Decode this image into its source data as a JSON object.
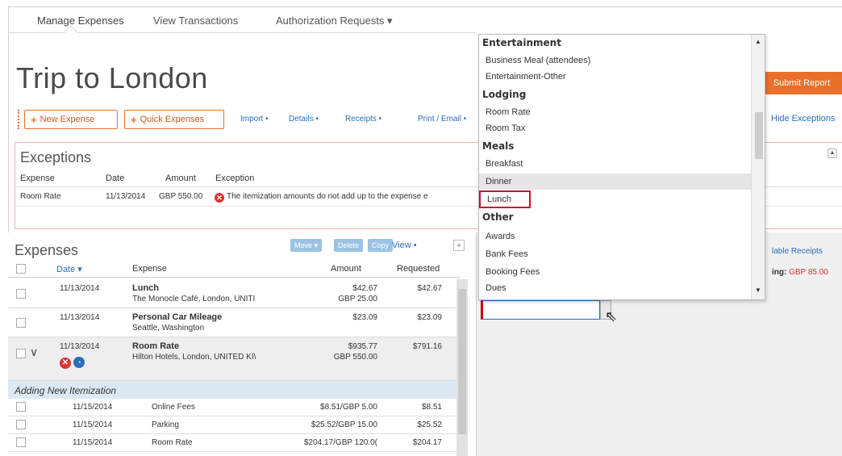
{
  "nav": {
    "tabs": [
      "Manage Expenses",
      "View Transactions",
      "Authorization Requests ▾"
    ]
  },
  "report": {
    "title": "Trip to London",
    "submit_label": "Submit Report"
  },
  "toolbar": {
    "new_expense": "New Expense",
    "quick_expenses": "Quick Expenses",
    "import": "Import •",
    "details": "Details •",
    "receipts": "Receipts •",
    "print_email": "Print / Email •",
    "hide_exceptions": "Hide Exceptions"
  },
  "exceptions": {
    "title": "Exceptions",
    "headers": {
      "expense": "Expense",
      "date": "Date",
      "amount": "Amount",
      "exception": "Exception"
    },
    "row": {
      "expense": "Room Rate",
      "date": "11/13/2014",
      "amount": "GBP 550.00",
      "message": "The itemization amounts do not add up to the expense e"
    }
  },
  "expenses": {
    "title": "Expenses",
    "move": "Move ▾",
    "delete": "Delete",
    "copy": "Copy",
    "view": "View •",
    "headers": {
      "date": "Date ▾",
      "expense": "Expense",
      "amount": "Amount",
      "requested": "Requested"
    },
    "rows": [
      {
        "date": "11/13/2014",
        "name": "Lunch",
        "sub": "The Monocle Café, London, UNITI",
        "amount": "$42.67",
        "amount2": "GBP 25.00",
        "requested": "$42.67"
      },
      {
        "date": "11/13/2014",
        "name": "Personal Car Mileage",
        "sub": "Seattle, Washington",
        "amount": "$23.09",
        "amount2": "",
        "requested": "$23.09"
      },
      {
        "date": "11/13/2014",
        "name": "Room Rate",
        "sub": "Hilton Hotels, London, UNITED KI\\",
        "amount": "$935.77",
        "amount2": "GBP 550.00",
        "requested": "$791.16"
      }
    ],
    "adding_label": "Adding New Itemization",
    "itemizations": [
      {
        "date": "11/15/2014",
        "type": "Online Fees",
        "amount": "$8.51/GBP 5.00",
        "requested": "$8.51"
      },
      {
        "date": "11/15/2014",
        "type": "Parking",
        "amount": "$25.52/GBP 15.00",
        "requested": "$25.52"
      },
      {
        "date": "11/15/2014",
        "type": "Room Rate",
        "amount": "$204.17/GBP 120.0(",
        "requested": "$204.17"
      }
    ]
  },
  "right_panel": {
    "available_receipts": "lable Receipts",
    "remaining_label": "ing:",
    "remaining_value": "GBP 85.00"
  },
  "dropdown": {
    "items": [
      {
        "label": "Entertainment",
        "group": true
      },
      {
        "label": "Business Meal (attendees)",
        "group": false
      },
      {
        "label": "Entertainment-Other",
        "group": false
      },
      {
        "label": "Lodging",
        "group": true
      },
      {
        "label": "Room Rate",
        "group": false
      },
      {
        "label": "Room Tax",
        "group": false
      },
      {
        "label": "Meals",
        "group": true
      },
      {
        "label": "Breakfast",
        "group": false
      },
      {
        "label": "Dinner",
        "group": false
      },
      {
        "label": "Lunch",
        "group": false
      },
      {
        "label": "Other",
        "group": true
      },
      {
        "label": "Awards",
        "group": false
      },
      {
        "label": "Bank Fees",
        "group": false
      },
      {
        "label": "Booking Fees",
        "group": false
      },
      {
        "label": "Dues",
        "group": false
      }
    ],
    "hovered": "Dinner",
    "highlighted": "Lunch"
  },
  "colors": {
    "accent": "#e8702a",
    "link": "#2a6ebb",
    "error": "#dd3333",
    "highlight_outline": "#c8102e"
  }
}
